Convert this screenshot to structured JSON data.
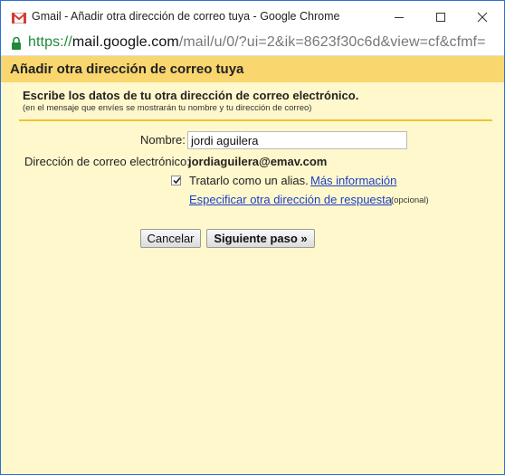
{
  "window": {
    "title": "Gmail - Añadir otra dirección de correo tuya - Google Chrome"
  },
  "address_bar": {
    "protocol": "https://",
    "host": "mail.google.com",
    "path": "/mail/u/0/?ui=2&ik=8623f30c6d&view=cf&cfmf="
  },
  "dialog": {
    "title": "Añadir otra dirección de correo tuya",
    "intro_title": "Escribe los datos de tu otra dirección de correo electrónico.",
    "intro_subtitle": "(en el mensaje que envíes se mostrarán tu nombre y tu dirección de correo)",
    "name_label": "Nombre:",
    "name_value": "jordi aguilera",
    "email_label": "Dirección de correo electrónico:",
    "email_value": "jordiaguilera@emav.com",
    "alias_checkbox": {
      "label": "Tratarlo como un alias.",
      "checked": true
    },
    "more_info_link": "Más información",
    "reply_to_link": "Especificar otra dirección de respuesta",
    "optional_note": "(opcional)",
    "cancel_button": "Cancelar",
    "next_button": "Siguiente paso »"
  },
  "colors": {
    "header_bg": "#f9d66e",
    "content_bg": "#fff8cc",
    "link": "#1c3ec7",
    "divider": "#f1c232",
    "window_border": "#2b6fd6"
  },
  "icons": [
    "gmail-icon",
    "minimize-icon",
    "maximize-icon",
    "close-icon",
    "lock-icon",
    "checkmark-icon"
  ]
}
